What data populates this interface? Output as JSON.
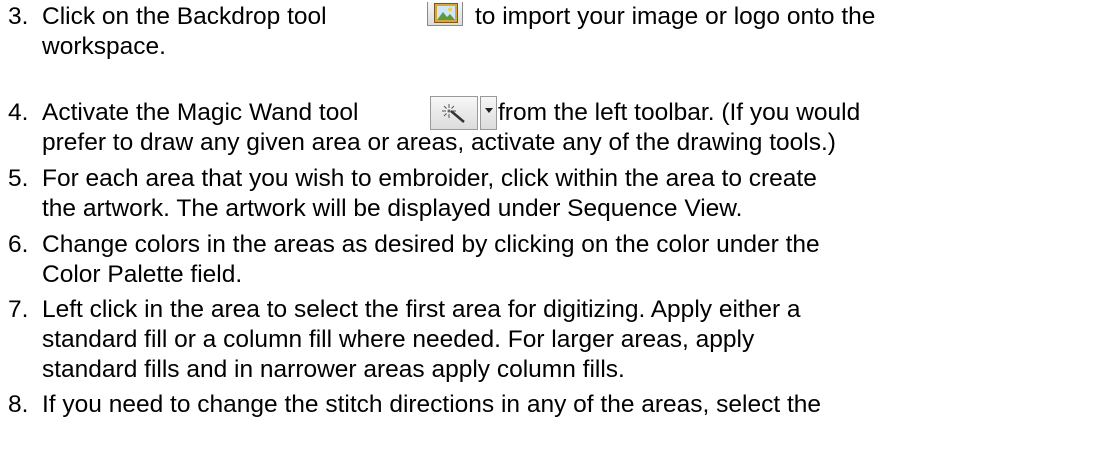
{
  "steps": [
    {
      "number": "3.",
      "lines": [
        "Click on the Backdrop tool",
        "to import your image or logo onto the",
        "workspace."
      ]
    },
    {
      "number": "4.",
      "lines": [
        "Activate the Magic Wand tool",
        "from the left toolbar. (If you would",
        "prefer to draw any given area or areas, activate any of the drawing tools.)"
      ]
    },
    {
      "number": "5.",
      "lines": [
        "For each area that you wish to embroider, click within the area to create",
        "the artwork. The artwork will be displayed under Sequence View."
      ]
    },
    {
      "number": "6.",
      "lines": [
        "Change colors in the areas as desired by clicking on the color under the",
        "Color Palette field."
      ]
    },
    {
      "number": "7.",
      "lines": [
        "Left click in the area to select the first area for digitizing. Apply either a",
        "standard fill or a column fill where needed.  For larger areas, apply",
        "standard fills and in narrower areas apply column fills."
      ]
    },
    {
      "number": "8.",
      "lines": [
        "If you need to change the stitch directions in any of the areas, select the"
      ]
    }
  ],
  "icons": {
    "backdrop": "backdrop-tool-icon",
    "magic_wand": "magic-wand-icon",
    "dropdown": "dropdown-arrow-icon"
  }
}
